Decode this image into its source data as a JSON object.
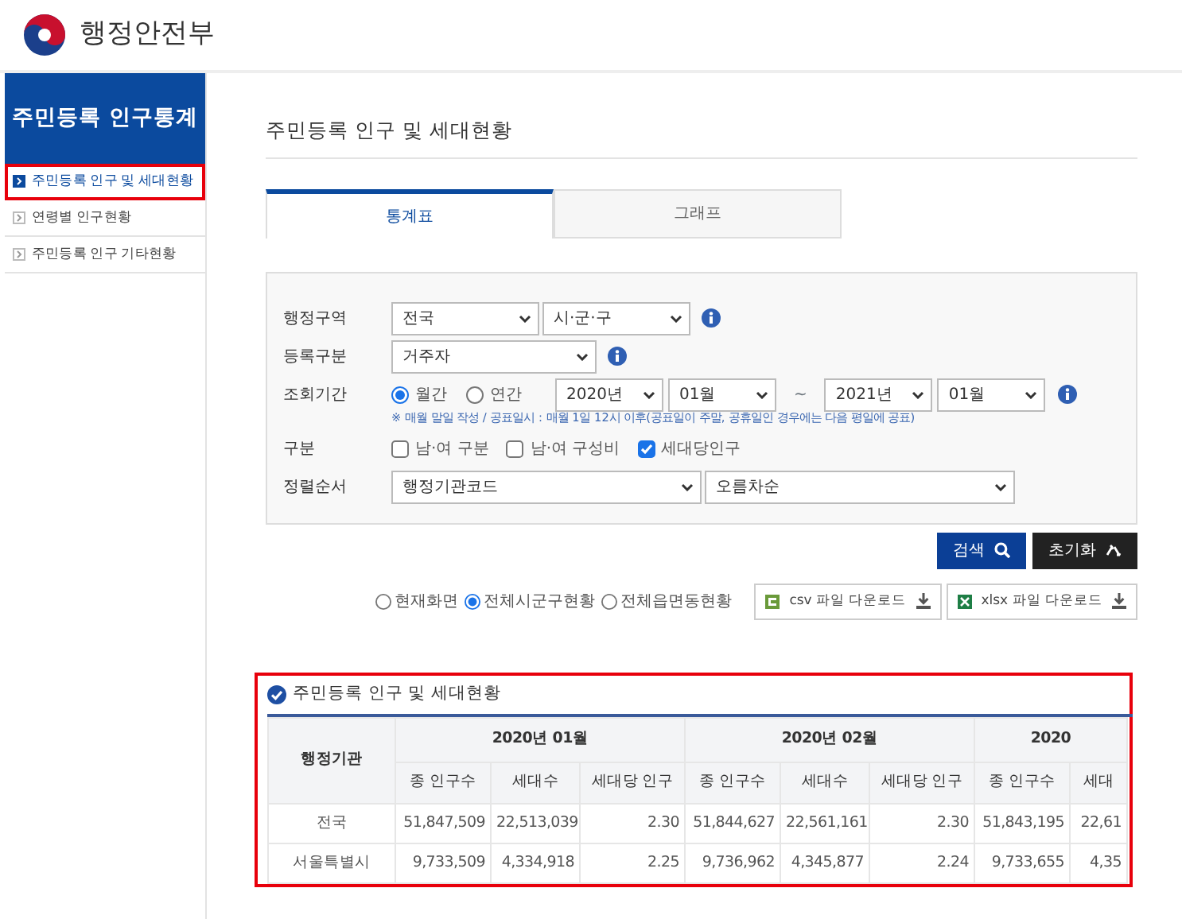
{
  "header": {
    "logo_text": "행정안전부"
  },
  "sidebar": {
    "title": "주민등록 인구통계",
    "items": [
      {
        "label": "주민등록 인구 및 세대현황",
        "selected": true,
        "highlighted": true
      },
      {
        "label": "연령별 인구현황",
        "selected": false,
        "highlighted": false
      },
      {
        "label": "주민등록 인구 기타현황",
        "selected": false,
        "highlighted": false
      }
    ]
  },
  "page_title": "주민등록 인구 및 세대현황",
  "tabs": [
    {
      "label": "통계표",
      "selected": true
    },
    {
      "label": "그래프",
      "selected": false
    }
  ],
  "filters": [
    {
      "label": "행정구역",
      "controls": [
        {
          "kind": "select",
          "value": "전국"
        },
        {
          "kind": "select",
          "value": "시·군·구"
        },
        {
          "kind": "info"
        }
      ]
    },
    {
      "label": "등록구분",
      "controls": [
        {
          "kind": "select",
          "value": "거주자"
        },
        {
          "kind": "info"
        }
      ]
    },
    {
      "label": "조회기간",
      "controls": [
        {
          "kind": "radio",
          "label": "월간",
          "selected": true
        },
        {
          "kind": "radio",
          "label": "연간",
          "selected": false
        },
        {
          "kind": "select",
          "value": "2020년"
        },
        {
          "kind": "select",
          "value": "01월"
        },
        {
          "kind": "text",
          "text": "~"
        },
        {
          "kind": "select",
          "value": "2021년"
        },
        {
          "kind": "select",
          "value": "01월"
        },
        {
          "kind": "info"
        }
      ],
      "note": "※ 매월 말일 작성 / 공표일시 : 매월 1일 12시 이후(공표일이 주말, 공휴일인 경우에는 다음 평일에 공표)"
    },
    {
      "label": "구분",
      "controls": [
        {
          "kind": "checkbox",
          "label": "남·여 구분",
          "checked": false
        },
        {
          "kind": "checkbox",
          "label": "남·여 구성비",
          "checked": false
        },
        {
          "kind": "checkbox",
          "label": "세대당인구",
          "checked": true
        }
      ]
    },
    {
      "label": "정렬순서",
      "controls": [
        {
          "kind": "select",
          "value": "행정기관코드"
        },
        {
          "kind": "select",
          "value": "오름차순"
        }
      ]
    }
  ],
  "buttons": [
    {
      "label": "검색",
      "kind": "search"
    },
    {
      "label": "초기화",
      "kind": "reset"
    }
  ],
  "export_scope": [
    {
      "label": "현재화면",
      "selected": false
    },
    {
      "label": "전체시군구현황",
      "selected": true
    },
    {
      "label": "전체읍면동현황",
      "selected": false
    }
  ],
  "downloads": [
    {
      "label": "csv 파일 다운로드",
      "kind": "csv"
    },
    {
      "label": "xlsx 파일 다운로드",
      "kind": "xlsx"
    }
  ],
  "result": {
    "title": "주민등록 인구 및 세대현황",
    "highlighted": true,
    "table": {
      "row_header": "행정기관",
      "groups": [
        {
          "label": "2020년 01월",
          "columns": [
            "종 인구수",
            "세대수",
            "세대당 인구"
          ]
        },
        {
          "label": "2020년 02월",
          "columns": [
            "종 인구수",
            "세대수",
            "세대당 인구"
          ]
        },
        {
          "label": "2020",
          "columns": [
            "종 인구수",
            "세대"
          ]
        }
      ],
      "rows": [
        {
          "name": "전국",
          "cells": [
            "51,847,509",
            "22,513,039",
            "2.30",
            "51,844,627",
            "22,561,161",
            "2.30",
            "51,843,195",
            "22,61"
          ]
        },
        {
          "name": "서울특별시",
          "cells": [
            "9,733,509",
            "4,334,918",
            "2.25",
            "9,736,962",
            "4,345,877",
            "2.24",
            "9,733,655",
            "4,35"
          ]
        }
      ]
    }
  }
}
